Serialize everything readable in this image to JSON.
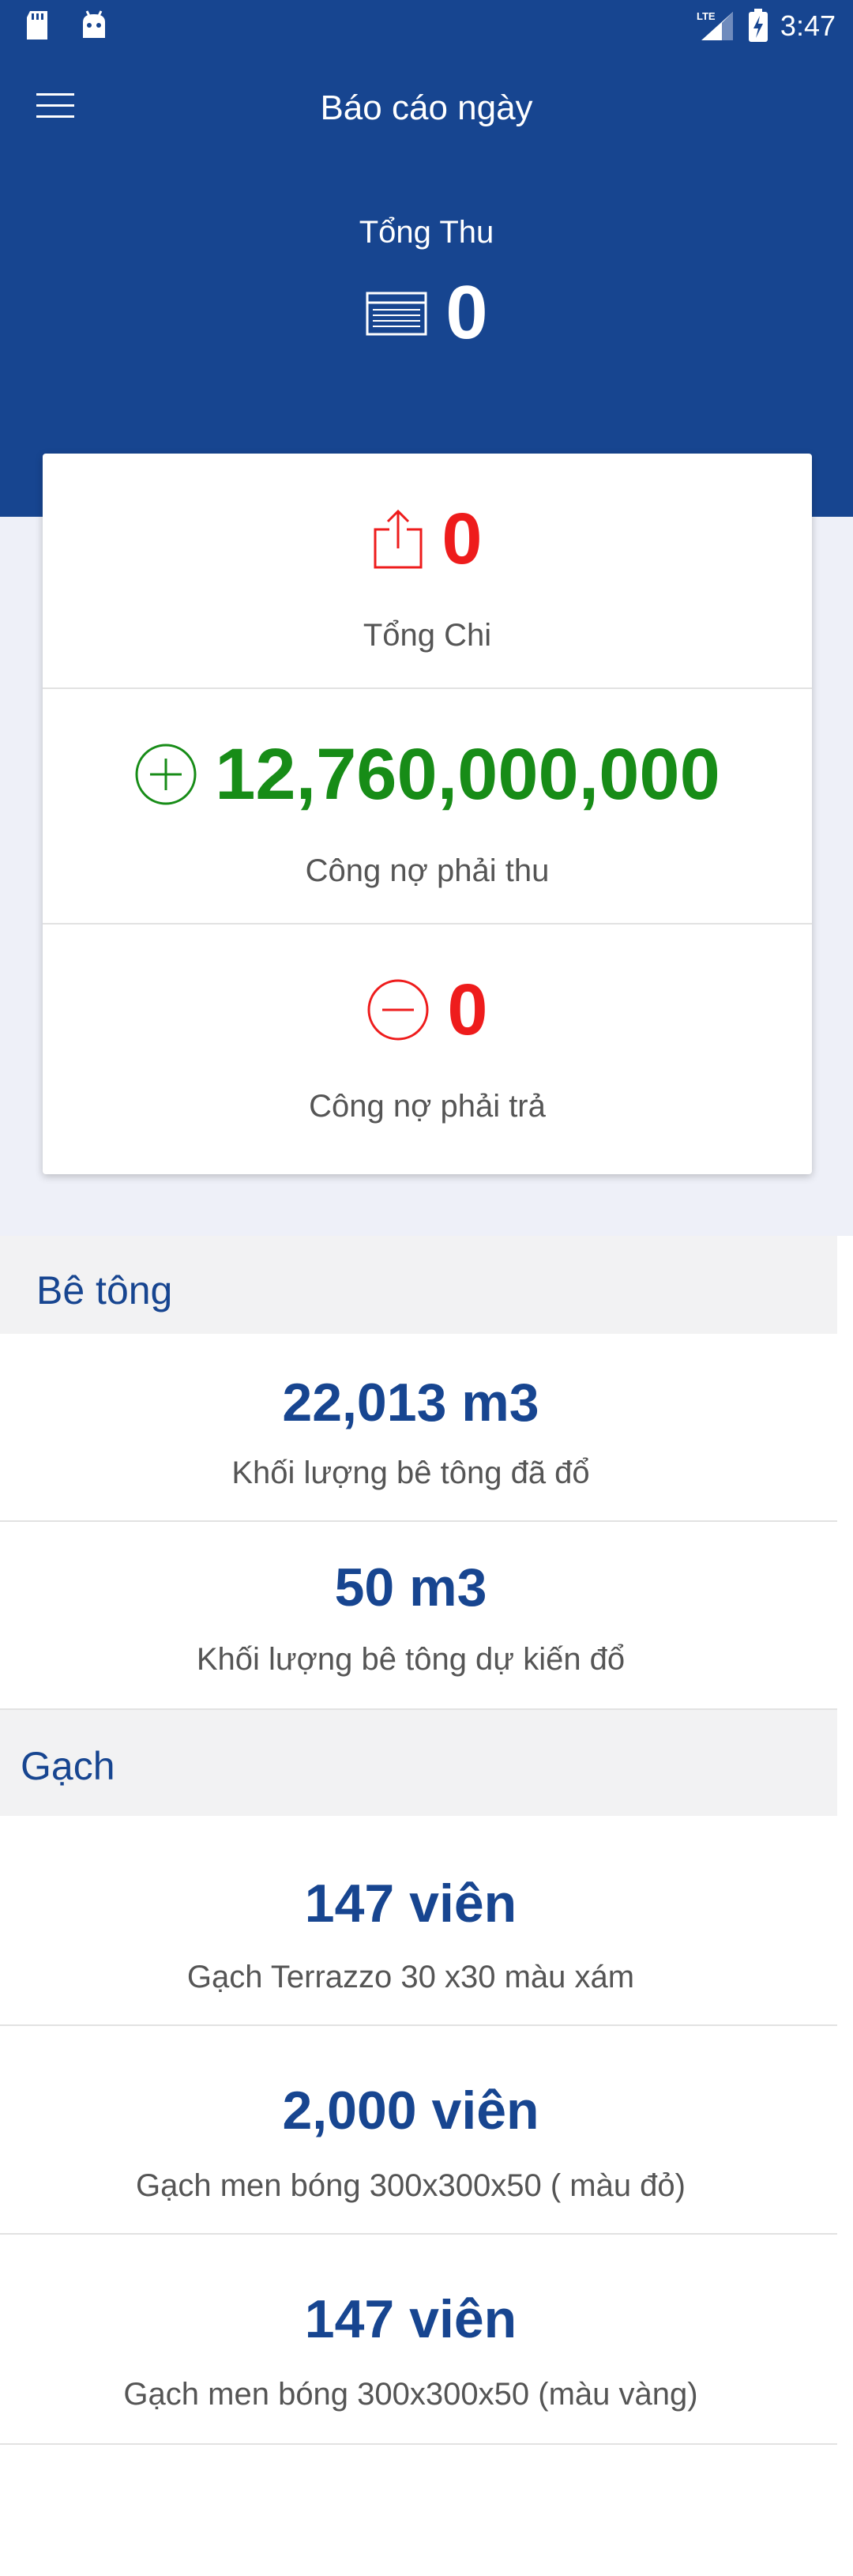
{
  "status_bar": {
    "time": "3:47",
    "network": "LTE"
  },
  "header": {
    "title": "Báo cáo ngày",
    "total_label": "Tổng Thu",
    "total_value": "0"
  },
  "summary": [
    {
      "value": "0",
      "label": "Tổng Chi",
      "color": "#ee1c1c"
    },
    {
      "value": "12,760,000,000",
      "label": "Công nợ phải thu",
      "color": "#178c17"
    },
    {
      "value": "0",
      "label": "Công nợ phải trả",
      "color": "#ee1c1c"
    }
  ],
  "be_tong": {
    "title": "Bê tông",
    "items": [
      {
        "value": "22,013 m3",
        "label": "Khối lượng bê tông đã đổ"
      },
      {
        "value": "50 m3",
        "label": "Khối lượng bê tông dự kiến đổ"
      }
    ]
  },
  "gach": {
    "title": "Gạch",
    "items": [
      {
        "value": "147 viên",
        "label": "Gạch Terrazzo 30 x30 màu xám"
      },
      {
        "value": "2,000 viên",
        "label": "Gạch  men bóng 300x300x50 ( màu đỏ)"
      },
      {
        "value": "147 viên",
        "label": "Gạch  men bóng 300x300x50 (màu vàng)"
      }
    ]
  },
  "colors": {
    "primary": "#174590",
    "expense": "#ee1c1c",
    "receivable": "#178c17"
  }
}
